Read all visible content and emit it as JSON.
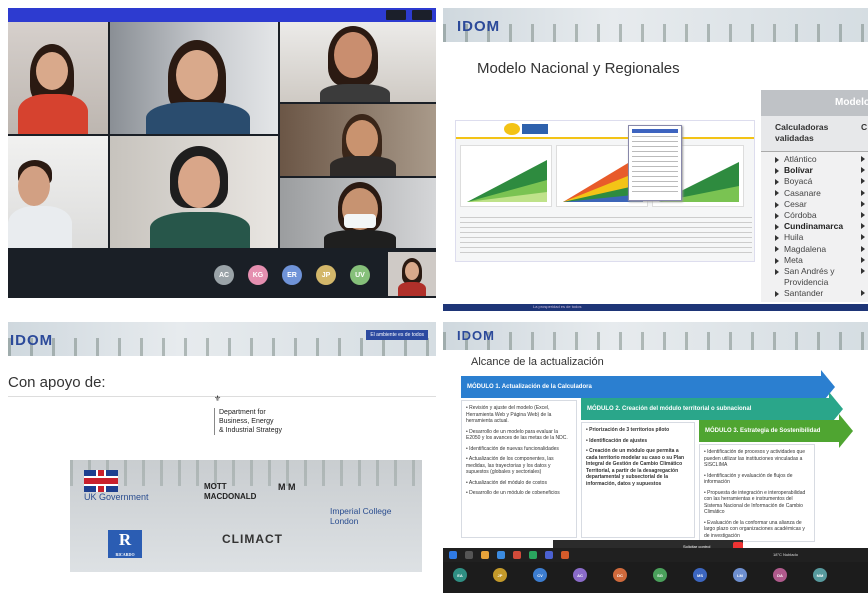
{
  "videocall": {
    "participants": [
      "AC",
      "KG",
      "ER",
      "JP",
      "UV"
    ],
    "participant_colors": [
      "#9aa3a8",
      "#e58fb0",
      "#6f93d8",
      "#d3b76a",
      "#86c07a"
    ]
  },
  "slide_regional": {
    "logo": "IDOM",
    "title": "Modelo Nacional y Regionales",
    "table_header": "Modelo",
    "col1_header_l1": "Calculadoras",
    "col1_header_l2": "validadas",
    "col2_header": "C",
    "regions": [
      {
        "name": "Atlántico",
        "bold": false
      },
      {
        "name": "Bolívar",
        "bold": true
      },
      {
        "name": "Boyacá",
        "bold": false
      },
      {
        "name": "Casanare",
        "bold": false
      },
      {
        "name": "Cesar",
        "bold": false
      },
      {
        "name": "Córdoba",
        "bold": false
      },
      {
        "name": "Cundinamarca",
        "bold": true
      },
      {
        "name": "Huila",
        "bold": false
      },
      {
        "name": "Magdalena",
        "bold": false
      },
      {
        "name": "Meta",
        "bold": false
      },
      {
        "name": "San Andrés y",
        "bold": false
      },
      {
        "name": "Providencia",
        "bold": false
      },
      {
        "name": "Santander",
        "bold": false
      }
    ],
    "footer": "La prosperidad es de todos"
  },
  "slide_support": {
    "logo": "IDOM",
    "title": "Con apoyo de:",
    "beis_l1": "Department for",
    "beis_l2": "Business, Energy",
    "beis_l3": "& Industrial Strategy",
    "ukgov": "UK Government",
    "mott_l1": "MOTT",
    "mott_l2": "MACDONALD",
    "mm": "M   M",
    "imperial_l1": "Imperial College",
    "imperial_l2": "London",
    "ricardo": "R",
    "ricardo_small": "RICARDO",
    "climact": "CLIMACT",
    "minlogo": "El ambiente es de todos"
  },
  "slide_scope": {
    "logo": "IDOM",
    "title": "Alcance de la actualización",
    "module1": "MÓDULO 1. Actualización de la Calculadora",
    "module2": "MÓDULO 2. Creación del módulo territorial o subnacional",
    "module3": "MÓDULO 3. Estrategia de Sostenibilidad",
    "module1_items": [
      "• Revisión y ajuste del modelo (Excel, Herramienta Web y Página Web) de la herramienta actual.",
      "• Desarrollo de un modelo para evaluar la E2050 y los avances de las metas de la NDC.",
      "• Identificación de nuevas funcionalidades",
      "• Actualización de los componentes, las medidas, las trayectorias y los datos y supuestos (globales y sectoriales)",
      "• Actualización del módulo de costos",
      "• Desarrollo de un módulo de cobeneficios"
    ],
    "module2_items": [
      "• Priorización de 3 territorios piloto",
      "• Identificación de ajustes",
      "• Creación de un módulo que permita a cada territorio modelar su caso o su Plan Integral de Gestión de Cambio Climático Territorial, a partir de la desagregación departamental y subsectorial de la información, datos y supuestos"
    ],
    "module3_items": [
      "• Identificación de procesos y actividades que pueden utilizar las instituciones vinculadas a SISCLIMA",
      "• Identificación y evaluación de flujos de información",
      "• Propuesta de integración e interoperabilidad con las herramientas e instrumentos del Sistema Nacional de Información de Cambio Climático",
      "• Evaluación de la conformar una alianza de largo plazo con organizaciones académicas y de investigación"
    ],
    "meet_label": "Solicitar control",
    "weather": "18°C Nublado",
    "bottom_avatars": [
      "EA",
      "JP",
      "CV",
      "AC",
      "DC",
      "SG",
      "MS",
      "LM",
      "DA",
      "MM"
    ]
  }
}
